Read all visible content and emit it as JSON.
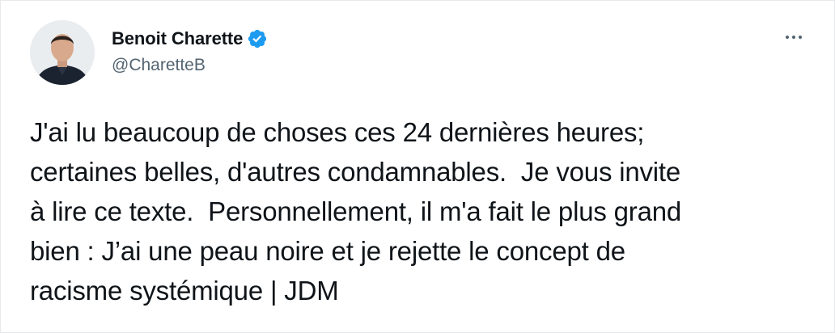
{
  "author": {
    "display_name": "Benoit Charette",
    "handle": "@CharetteB",
    "verified": true,
    "avatar_icon": "profile-photo"
  },
  "tweet": {
    "text": "J'ai lu beaucoup de choses ces 24 dernières heures;\ncertaines belles, d'autres condamnables.  Je vous invite\nà lire ce texte.  Personnellement, il m'a fait le plus grand\nbien : J’ai une peau noire et je rejette le concept de\nracisme systémique | JDM"
  },
  "icons": {
    "verified": "verified-badge-icon",
    "more": "more-options-icon"
  },
  "colors": {
    "verified_blue": "#1d9bf0",
    "text_primary": "#0f1419",
    "text_secondary": "#536471"
  }
}
